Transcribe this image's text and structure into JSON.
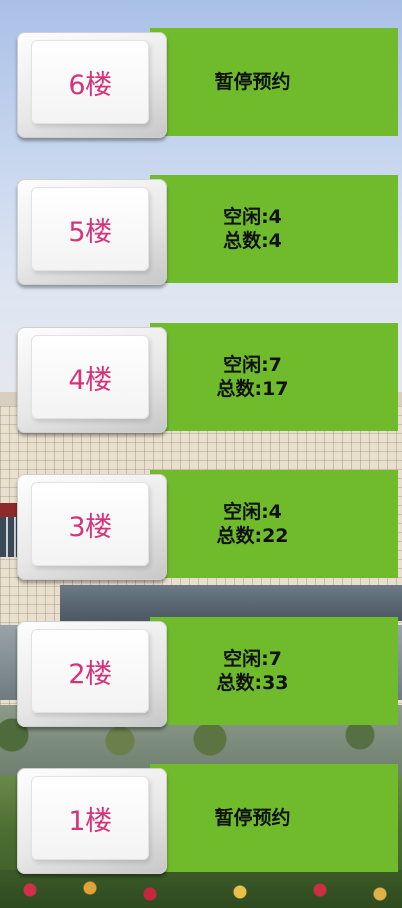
{
  "floors": [
    {
      "label": "6楼",
      "line1": "暂停预约",
      "line2": ""
    },
    {
      "label": "5楼",
      "line1": "空闲:4",
      "line2": "总数:4"
    },
    {
      "label": "4楼",
      "line1": "空闲:7",
      "line2": "总数:17"
    },
    {
      "label": "3楼",
      "line1": "空闲:4",
      "line2": "总数:22"
    },
    {
      "label": "2楼",
      "line1": "空闲:7",
      "line2": "总数:33"
    },
    {
      "label": "1楼",
      "line1": "暂停预约",
      "line2": ""
    }
  ],
  "colors": {
    "status_bg": "#6fbb2c",
    "floor_label": "#d4337a",
    "status_text": "#111111"
  }
}
